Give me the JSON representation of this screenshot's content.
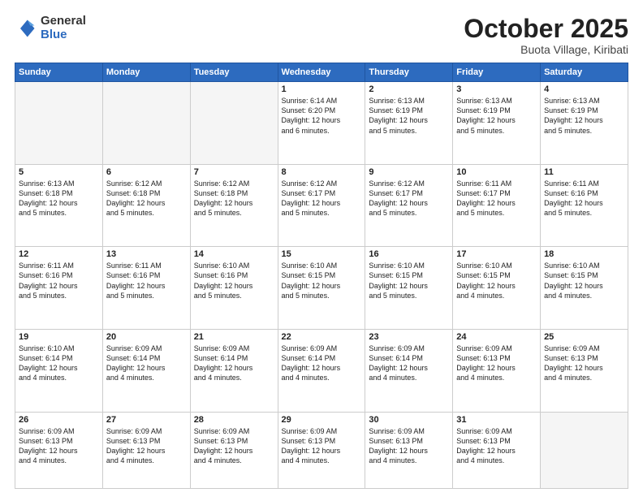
{
  "header": {
    "logo_general": "General",
    "logo_blue": "Blue",
    "month_title": "October 2025",
    "location": "Buota Village, Kiribati"
  },
  "weekdays": [
    "Sunday",
    "Monday",
    "Tuesday",
    "Wednesday",
    "Thursday",
    "Friday",
    "Saturday"
  ],
  "weeks": [
    [
      {
        "day": "",
        "text": ""
      },
      {
        "day": "",
        "text": ""
      },
      {
        "day": "",
        "text": ""
      },
      {
        "day": "1",
        "text": "Sunrise: 6:14 AM\nSunset: 6:20 PM\nDaylight: 12 hours\nand 6 minutes."
      },
      {
        "day": "2",
        "text": "Sunrise: 6:13 AM\nSunset: 6:19 PM\nDaylight: 12 hours\nand 5 minutes."
      },
      {
        "day": "3",
        "text": "Sunrise: 6:13 AM\nSunset: 6:19 PM\nDaylight: 12 hours\nand 5 minutes."
      },
      {
        "day": "4",
        "text": "Sunrise: 6:13 AM\nSunset: 6:19 PM\nDaylight: 12 hours\nand 5 minutes."
      }
    ],
    [
      {
        "day": "5",
        "text": "Sunrise: 6:13 AM\nSunset: 6:18 PM\nDaylight: 12 hours\nand 5 minutes."
      },
      {
        "day": "6",
        "text": "Sunrise: 6:12 AM\nSunset: 6:18 PM\nDaylight: 12 hours\nand 5 minutes."
      },
      {
        "day": "7",
        "text": "Sunrise: 6:12 AM\nSunset: 6:18 PM\nDaylight: 12 hours\nand 5 minutes."
      },
      {
        "day": "8",
        "text": "Sunrise: 6:12 AM\nSunset: 6:17 PM\nDaylight: 12 hours\nand 5 minutes."
      },
      {
        "day": "9",
        "text": "Sunrise: 6:12 AM\nSunset: 6:17 PM\nDaylight: 12 hours\nand 5 minutes."
      },
      {
        "day": "10",
        "text": "Sunrise: 6:11 AM\nSunset: 6:17 PM\nDaylight: 12 hours\nand 5 minutes."
      },
      {
        "day": "11",
        "text": "Sunrise: 6:11 AM\nSunset: 6:16 PM\nDaylight: 12 hours\nand 5 minutes."
      }
    ],
    [
      {
        "day": "12",
        "text": "Sunrise: 6:11 AM\nSunset: 6:16 PM\nDaylight: 12 hours\nand 5 minutes."
      },
      {
        "day": "13",
        "text": "Sunrise: 6:11 AM\nSunset: 6:16 PM\nDaylight: 12 hours\nand 5 minutes."
      },
      {
        "day": "14",
        "text": "Sunrise: 6:10 AM\nSunset: 6:16 PM\nDaylight: 12 hours\nand 5 minutes."
      },
      {
        "day": "15",
        "text": "Sunrise: 6:10 AM\nSunset: 6:15 PM\nDaylight: 12 hours\nand 5 minutes."
      },
      {
        "day": "16",
        "text": "Sunrise: 6:10 AM\nSunset: 6:15 PM\nDaylight: 12 hours\nand 5 minutes."
      },
      {
        "day": "17",
        "text": "Sunrise: 6:10 AM\nSunset: 6:15 PM\nDaylight: 12 hours\nand 4 minutes."
      },
      {
        "day": "18",
        "text": "Sunrise: 6:10 AM\nSunset: 6:15 PM\nDaylight: 12 hours\nand 4 minutes."
      }
    ],
    [
      {
        "day": "19",
        "text": "Sunrise: 6:10 AM\nSunset: 6:14 PM\nDaylight: 12 hours\nand 4 minutes."
      },
      {
        "day": "20",
        "text": "Sunrise: 6:09 AM\nSunset: 6:14 PM\nDaylight: 12 hours\nand 4 minutes."
      },
      {
        "day": "21",
        "text": "Sunrise: 6:09 AM\nSunset: 6:14 PM\nDaylight: 12 hours\nand 4 minutes."
      },
      {
        "day": "22",
        "text": "Sunrise: 6:09 AM\nSunset: 6:14 PM\nDaylight: 12 hours\nand 4 minutes."
      },
      {
        "day": "23",
        "text": "Sunrise: 6:09 AM\nSunset: 6:14 PM\nDaylight: 12 hours\nand 4 minutes."
      },
      {
        "day": "24",
        "text": "Sunrise: 6:09 AM\nSunset: 6:13 PM\nDaylight: 12 hours\nand 4 minutes."
      },
      {
        "day": "25",
        "text": "Sunrise: 6:09 AM\nSunset: 6:13 PM\nDaylight: 12 hours\nand 4 minutes."
      }
    ],
    [
      {
        "day": "26",
        "text": "Sunrise: 6:09 AM\nSunset: 6:13 PM\nDaylight: 12 hours\nand 4 minutes."
      },
      {
        "day": "27",
        "text": "Sunrise: 6:09 AM\nSunset: 6:13 PM\nDaylight: 12 hours\nand 4 minutes."
      },
      {
        "day": "28",
        "text": "Sunrise: 6:09 AM\nSunset: 6:13 PM\nDaylight: 12 hours\nand 4 minutes."
      },
      {
        "day": "29",
        "text": "Sunrise: 6:09 AM\nSunset: 6:13 PM\nDaylight: 12 hours\nand 4 minutes."
      },
      {
        "day": "30",
        "text": "Sunrise: 6:09 AM\nSunset: 6:13 PM\nDaylight: 12 hours\nand 4 minutes."
      },
      {
        "day": "31",
        "text": "Sunrise: 6:09 AM\nSunset: 6:13 PM\nDaylight: 12 hours\nand 4 minutes."
      },
      {
        "day": "",
        "text": ""
      }
    ]
  ]
}
